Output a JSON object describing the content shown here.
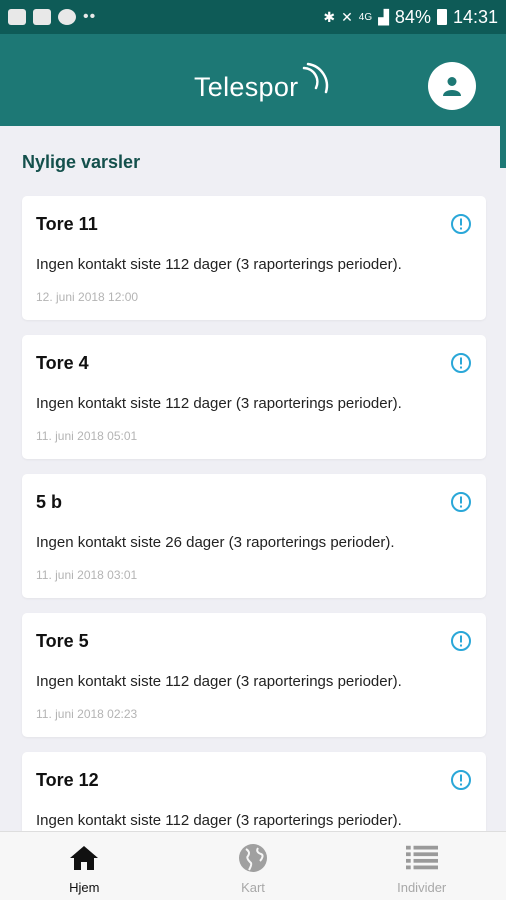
{
  "status_bar": {
    "battery": "84%",
    "time": "14:31",
    "network": "4G"
  },
  "app": {
    "title": "Telespor",
    "accent_color": "#1d7875",
    "alert_icon_color": "#2aa7d8"
  },
  "section": {
    "title": "Nylige varsler"
  },
  "alerts": [
    {
      "name": "Tore 11",
      "message": "Ingen kontakt siste 112 dager (3 raporterings perioder).",
      "date": "12. juni 2018 12:00"
    },
    {
      "name": "Tore 4",
      "message": "Ingen kontakt siste 112 dager (3 raporterings perioder).",
      "date": "11. juni 2018 05:01"
    },
    {
      "name": "5 b",
      "message": "Ingen kontakt siste 26 dager (3 raporterings perioder).",
      "date": "11. juni 2018 03:01"
    },
    {
      "name": "Tore 5",
      "message": "Ingen kontakt siste 112 dager (3 raporterings perioder).",
      "date": "11. juni 2018 02:23"
    },
    {
      "name": "Tore 12",
      "message": "Ingen kontakt siste 112 dager (3 raporterings perioder).",
      "date": ""
    }
  ],
  "nav": [
    {
      "label": "Hjem",
      "icon": "home-icon",
      "active": true
    },
    {
      "label": "Kart",
      "icon": "globe-icon",
      "active": false
    },
    {
      "label": "Individer",
      "icon": "list-icon",
      "active": false
    }
  ]
}
